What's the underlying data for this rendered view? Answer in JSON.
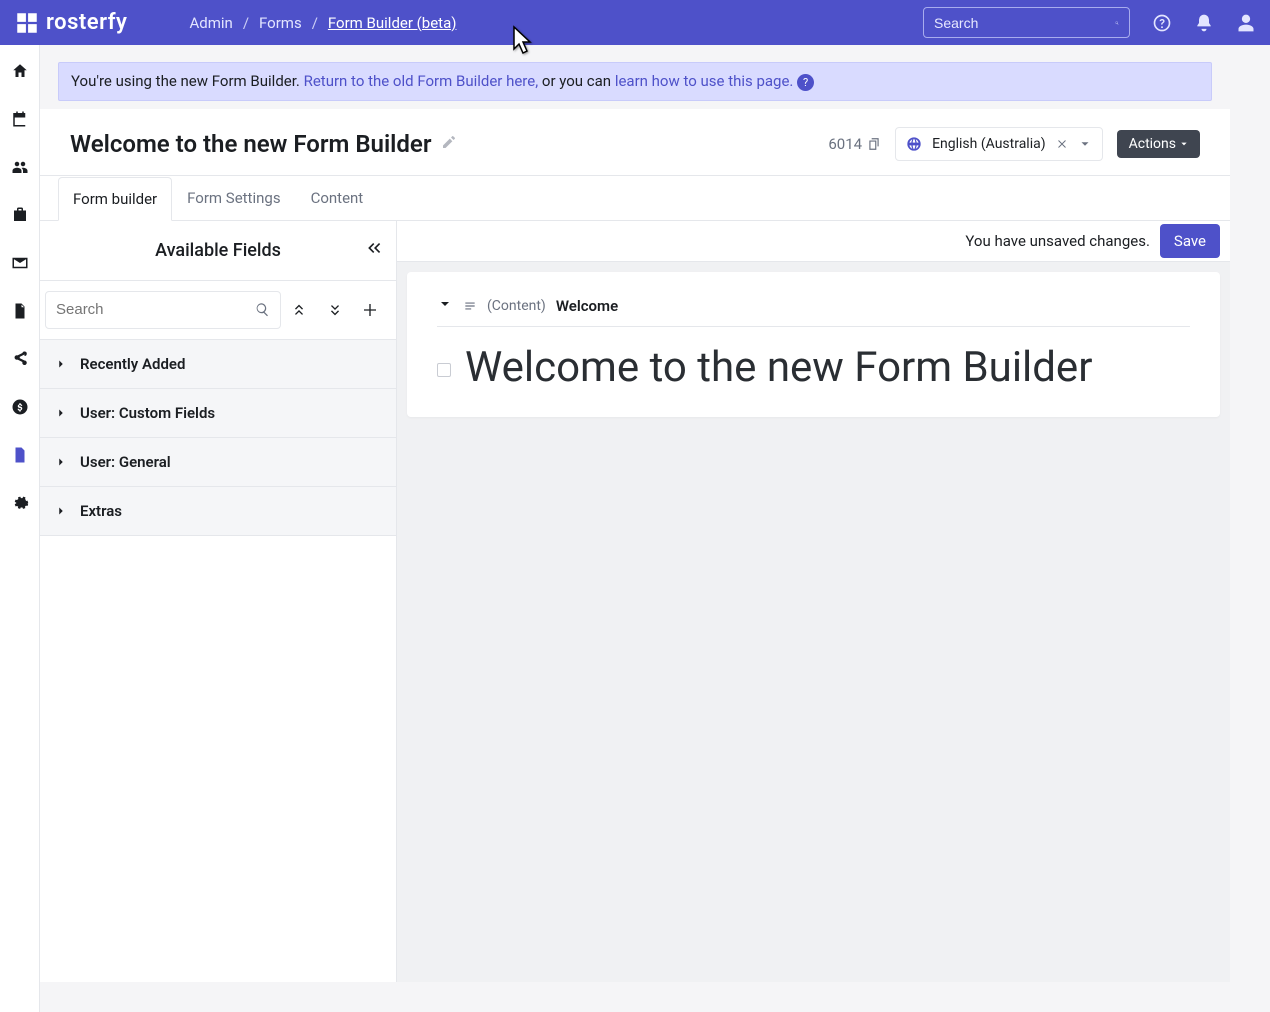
{
  "brand": {
    "name": "rosterfy"
  },
  "breadcrumbs": {
    "items": [
      "Admin",
      "Forms"
    ],
    "current": "Form Builder (beta)"
  },
  "topbar": {
    "search_placeholder": "Search"
  },
  "banner": {
    "t1": "You're using the new Form Builder. ",
    "link1": "Return to the old Form Builder here,",
    "t2": " or you can ",
    "link2": "learn how to use this page.",
    "help": "?"
  },
  "page": {
    "title": "Welcome to the new Form Builder",
    "form_id": "6014",
    "language": "English (Australia)",
    "actions_label": "Actions"
  },
  "tabs": {
    "items": [
      "Form builder",
      "Form Settings",
      "Content"
    ],
    "active": 0
  },
  "fields_panel": {
    "title": "Available Fields",
    "search_placeholder": "Search",
    "groups": [
      "Recently Added",
      "User: Custom Fields",
      "User: General",
      "Extras"
    ]
  },
  "savebar": {
    "msg": "You have unsaved changes.",
    "save": "Save"
  },
  "section": {
    "type_label": "(Content)",
    "name": "Welcome",
    "title_text": "Welcome to the new Form Builder"
  }
}
